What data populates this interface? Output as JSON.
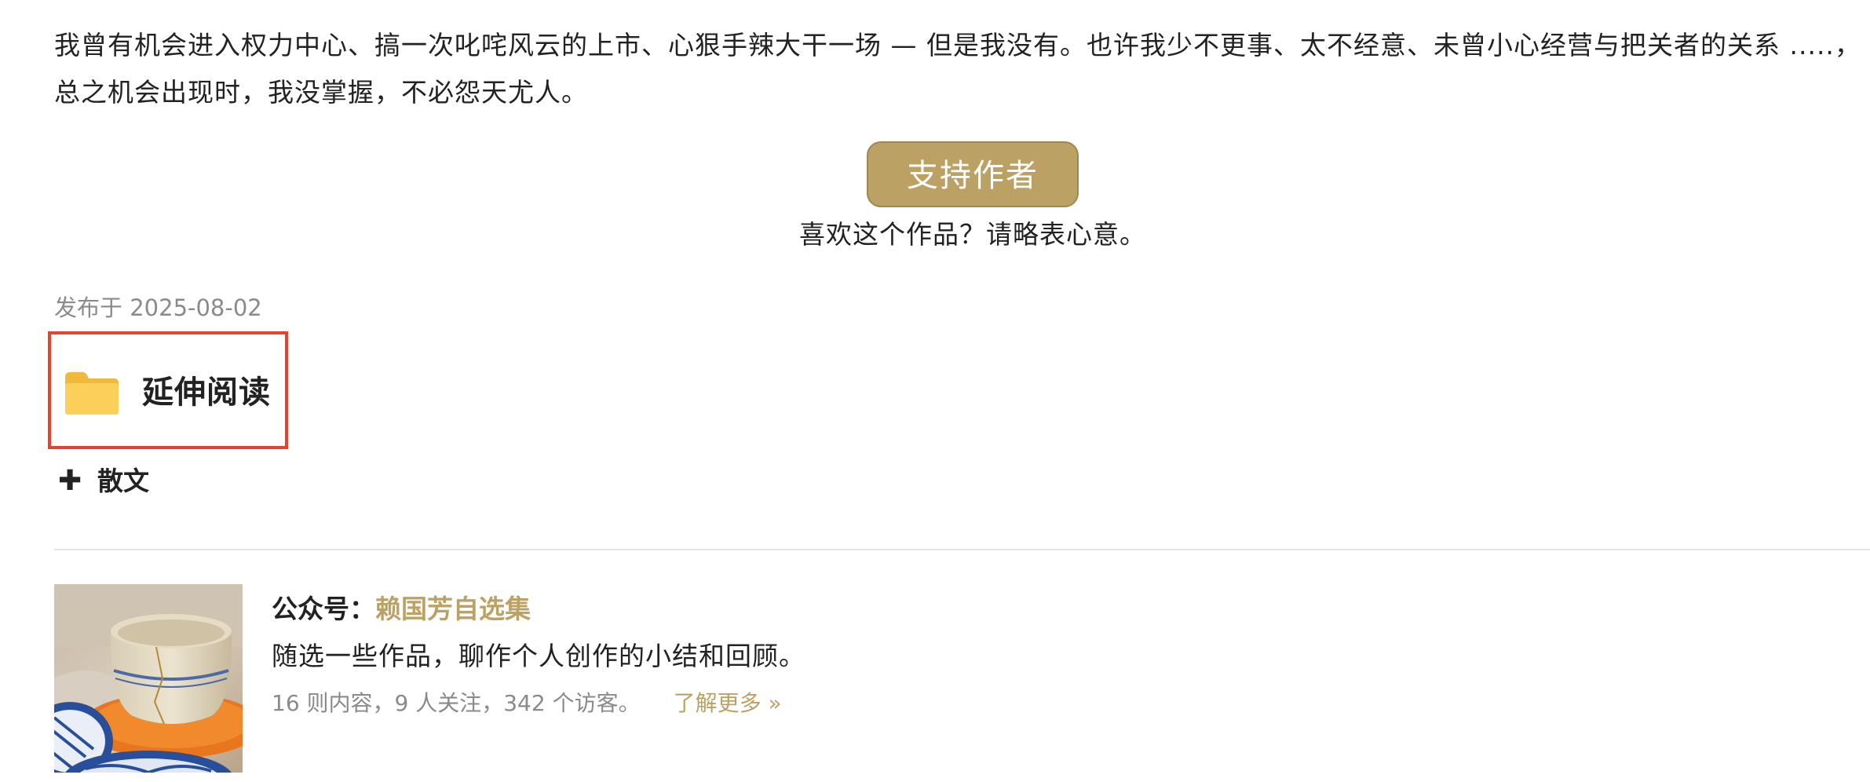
{
  "article": {
    "line1": "我曾有机会进入权力中心、搞一次叱咤风云的上市、心狠手辣大干一场 — 但是我没有。也许我少不更事、太不经意、未曾小心经营与把关者的关系 .....，",
    "line2": "总之机会出现时，我没掌握，不必怨天尤人。"
  },
  "support": {
    "button_label": "支持作者",
    "caption": "喜欢这个作品？请略表心意。"
  },
  "publish_date": "发布于 2025-08-02",
  "extended_reading": {
    "icon": "folder-icon",
    "title": "延伸阅读",
    "items": [
      {
        "icon": "plus-icon",
        "label": "散文"
      }
    ]
  },
  "account": {
    "prefix": "公众号：",
    "name": "赖国芳自选集",
    "description": "随选一些作品，聊作个人创作的小结和回顾。",
    "stats": "16 则内容，9 人关注，342 个访客。",
    "learn_more": "了解更多 »",
    "thumbnail": "teacup-photo"
  },
  "colors": {
    "accent": "#bca165",
    "highlight_border": "#e5432d",
    "folder": "#f5c445",
    "muted_text": "#8a8a8a"
  }
}
